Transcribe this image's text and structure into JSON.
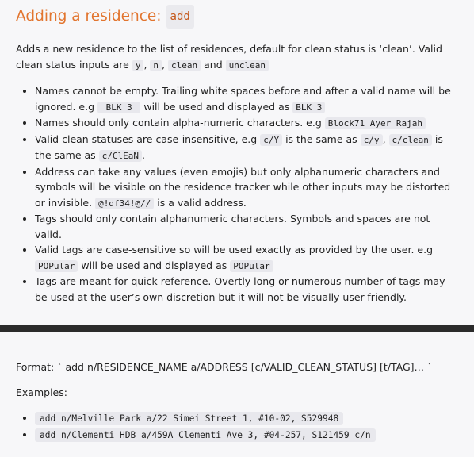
{
  "heading": {
    "text": "Adding a residence:",
    "command": "add"
  },
  "description": {
    "text_1": "Adds a new residence to the list of residences, default for clean status is ‘clean’. Valid clean status inputs are",
    "code_y": "y",
    "sep_1": ",",
    "code_n": "n",
    "sep_2": ",",
    "code_clean": "clean",
    "and": "and",
    "code_unclean": "unclean"
  },
  "notes": {
    "n1": {
      "text_1": "Names cannot be empty. Trailing white spaces before and after a valid name will be ignored. e.g",
      "code_1": " BLK 3 ",
      "text_2": "will be used and displayed as",
      "code_2": "BLK 3"
    },
    "n2": {
      "text_1": "Names should only contain alpha-numeric characters. e.g",
      "code_1": "Block71 Ayer Rajah"
    },
    "n3": {
      "text_1": "Valid clean statuses are case-insensitive, e.g",
      "code_1": "c/Y",
      "text_2": "is the same as",
      "code_2": "c/y",
      "sep": ",",
      "code_3": "c/clean",
      "text_3": "is the same as",
      "code_4": "c/ClEaN",
      "end": "."
    },
    "n4": {
      "text_1": "Address can take any values (even emojis) but only alphanumeric characters and symbols will be visible on the residence tracker while other inputs may be distorted or invisible.",
      "code_1": "@!df34!@//",
      "text_2": "is a valid address."
    },
    "n5": {
      "text_1": "Tags should only contain alphanumeric characters. Symbols and spaces are not valid."
    },
    "n6": {
      "text_1": "Valid tags are case-sensitive so will be used exactly as provided by the user. e.g",
      "code_1": "POPular",
      "text_2": "will be used and displayed as",
      "code_2": "POPular"
    },
    "n7": {
      "text_1": "Tags are meant for quick reference. Overtly long or numerous number of tags may be used at the user’s own discretion but it will not be visually user-friendly."
    }
  },
  "format": {
    "text": "Format: ` add n/RESIDENCE_NAME a/ADDRESS [c/VALID_CLEAN_STATUS] [t/TAG]… `"
  },
  "examples": {
    "title": "Examples:",
    "items": [
      "add n/Melville Park a/22 Simei Street 1, #10-02, S529948",
      "add n/Clementi HDB a/459A Clementi Ave 3, #04-257, S121459 c/n"
    ]
  }
}
